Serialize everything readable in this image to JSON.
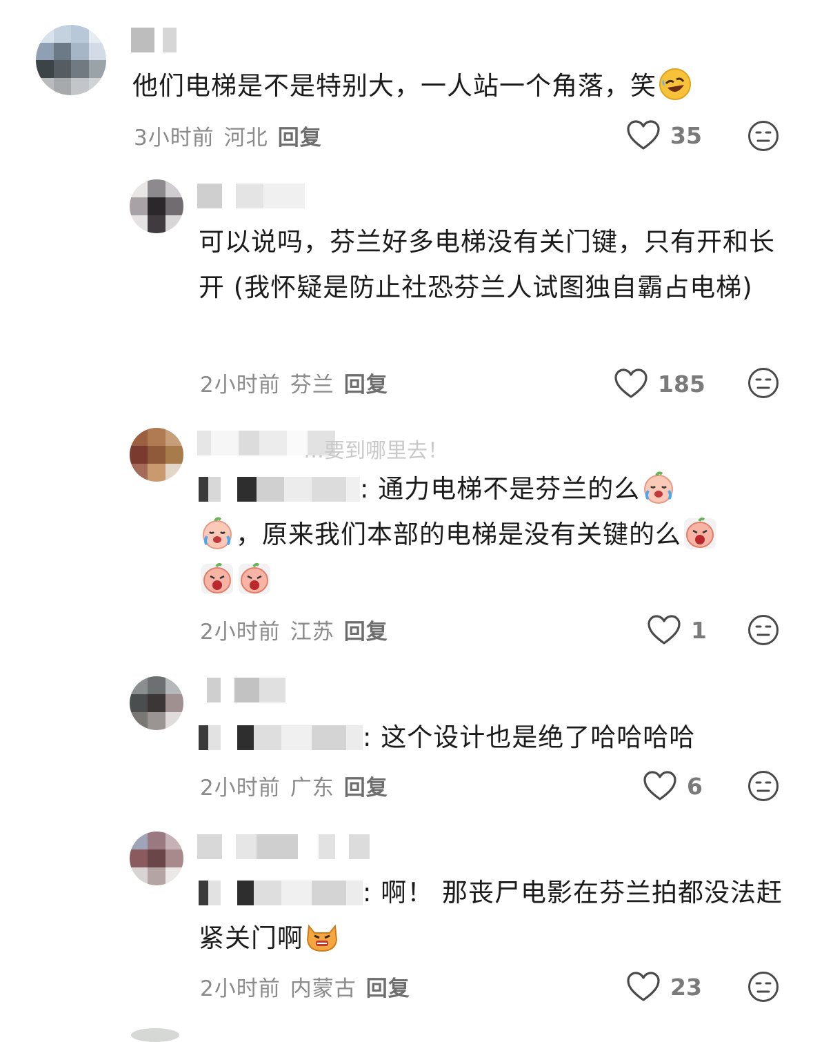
{
  "colors": {
    "meta_gray": "#8a8a8a",
    "text": "#1b1b1b",
    "icon_stroke": "#4a4a4a"
  },
  "icons": {
    "like": "heart-outline-icon",
    "dislike": "meh-face-icon"
  },
  "comments": [
    {
      "text": "他们电梯是不是特别大，一人站一个角落，笑",
      "time": "3小时前",
      "location": "河北",
      "reply_label": "回复",
      "likes": "35"
    },
    {
      "text": "可以说吗，芬兰好多电梯没有关门键，只有开和长开 (我怀疑是防止社恐芬兰人试图独自霸占电梯)",
      "time": "2小时前",
      "location": "芬兰",
      "reply_label": "回复",
      "likes": "185"
    },
    {
      "quote_fragment": "…要到哪里去！",
      "text_part1": ": 通力电梯不是芬兰的么",
      "text_part2": "，原来我们本部的电梯是没有关键的么",
      "time": "2小时前",
      "location": "江苏",
      "reply_label": "回复",
      "likes": "1"
    },
    {
      "text": ": 这个设计也是绝了哈哈哈哈",
      "time": "2小时前",
      "location": "广东",
      "reply_label": "回复",
      "likes": "6"
    },
    {
      "text": ": 啊！ 那丧尸电影在芬兰拍都没法赶紧关门啊",
      "time": "2小时前",
      "location": "内蒙古",
      "reply_label": "回复",
      "likes": "23"
    }
  ]
}
